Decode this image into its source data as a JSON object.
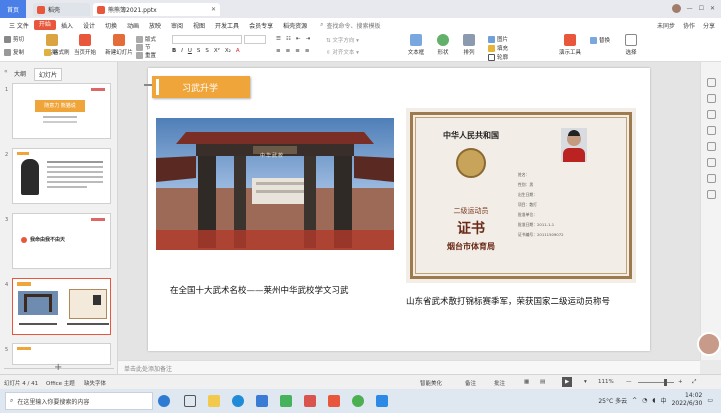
{
  "titlebar": {
    "home_tab": "首页",
    "doc_tab": "稻壳",
    "active_tab": "熊熊簿2021.pptx",
    "right_items": [
      "未同步",
      "协作",
      "分享"
    ]
  },
  "menubar": {
    "file": "三 文件",
    "items": [
      "开始",
      "插入",
      "设计",
      "切换",
      "动画",
      "放映",
      "审阅",
      "视图",
      "开发工具",
      "会员专享",
      "稻壳资源"
    ],
    "active": "开始",
    "search": "查找命令、搜索模板",
    "right_items": [
      "未同步",
      "协作",
      "分享"
    ]
  },
  "ribbon": {
    "cut": "剪切",
    "copy": "复制",
    "format_painter": "格式刷",
    "paste": "粘贴",
    "play_from_current": "当页开始",
    "new_slide": "新建幻灯片",
    "layout": "版式",
    "section": "节",
    "reset": "重置",
    "textbox": "文本框",
    "shapes": "形状",
    "arrange": "排列",
    "image": "图片",
    "fill": "填充",
    "outline": "轮廓",
    "presenter_tools": "演示工具",
    "replace": "替换",
    "select": "选择"
  },
  "leftpanel": {
    "tabs": [
      "大纲",
      "幻灯片"
    ],
    "active_tab": "幻灯片",
    "slide_numbers": [
      "1",
      "2",
      "3",
      "4",
      "5"
    ],
    "thumb1_title": "随意力 熊猫说",
    "thumb3_text": "我命由我不由天"
  },
  "slide": {
    "header_badge": "习武升学",
    "left_caption": "在全国十大武术名校——莱州中华武校学文习武",
    "right_caption": "山东省武术散打锦标赛季军，荣获国家二级运动员称号",
    "gate_sign": "中华武校",
    "certificate": {
      "country": "中华人民共和国",
      "level": "二级运动员",
      "title": "证书",
      "issuer": "烟台市体育局",
      "fields": [
        "姓名",
        "性别",
        "出生日期",
        "项目",
        "批准单位",
        "批准日期",
        "证书编号"
      ],
      "values": [
        "",
        "男",
        "",
        "散打",
        "",
        "2011-1-1",
        "20111509072"
      ]
    }
  },
  "notes_placeholder": "单击此处添加备注",
  "statusbar": {
    "slide_pos": "幻灯片 4 / 41",
    "theme": "Office 主题",
    "font_missing": "缺失字体",
    "smart_beauty": "智能美化",
    "notes": "备注",
    "comments": "批注",
    "zoom": "111%"
  },
  "taskbar": {
    "search_placeholder": "在这里输入你要搜索的内容",
    "weather": "25°C 多云",
    "time": "14:02",
    "date": "2022/6/30",
    "ime": "中"
  }
}
